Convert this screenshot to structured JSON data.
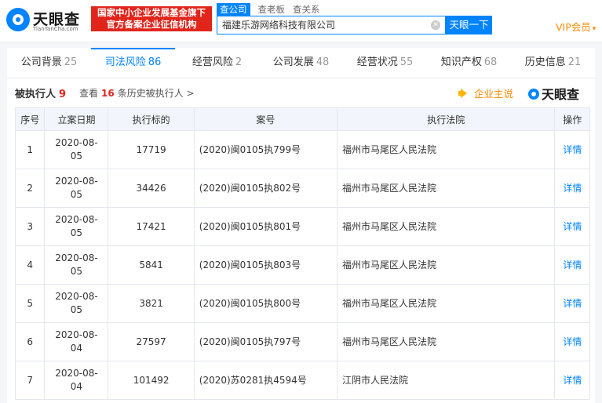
{
  "header": {
    "logo_text": "天眼查",
    "logo_sub": "TianYanCha.com",
    "banner_line1": "国家中小企业发展基金旗下",
    "banner_line2": "官方备案企业征信机构",
    "search_tabs": [
      "查公司",
      "查老板",
      "查关系"
    ],
    "search_value": "福建乐游网络科技有限公司",
    "search_button": "天眼一下",
    "vip_label": "VIP会员",
    "accent": "#0084ff"
  },
  "tabs": [
    {
      "label": "公司背景",
      "count": "25"
    },
    {
      "label": "司法风险",
      "count": "86"
    },
    {
      "label": "经营风险",
      "count": "2"
    },
    {
      "label": "公司发展",
      "count": "48"
    },
    {
      "label": "经营状况",
      "count": "55"
    },
    {
      "label": "知识产权",
      "count": "68"
    },
    {
      "label": "历史信息",
      "count": "21"
    }
  ],
  "section": {
    "title": "被执行人",
    "count": "9",
    "history_prefix": "查看",
    "history_count": "16",
    "history_suffix": "条历史被执行人 >",
    "speak_label": "企业主说",
    "brand": "天眼查"
  },
  "table": {
    "headers": [
      "序号",
      "立案日期",
      "执行标的",
      "案号",
      "执行法院",
      "操作"
    ],
    "rows": [
      {
        "no": "1",
        "date": "2020-08-05",
        "amount": "17719",
        "case": "(2020)闽0105执799号",
        "court": "福州市马尾区人民法院",
        "action": "详情"
      },
      {
        "no": "2",
        "date": "2020-08-05",
        "amount": "34426",
        "case": "(2020)闽0105执802号",
        "court": "福州市马尾区人民法院",
        "action": "详情"
      },
      {
        "no": "3",
        "date": "2020-08-05",
        "amount": "17421",
        "case": "(2020)闽0105执801号",
        "court": "福州市马尾区人民法院",
        "action": "详情"
      },
      {
        "no": "4",
        "date": "2020-08-05",
        "amount": "5841",
        "case": "(2020)闽0105执803号",
        "court": "福州市马尾区人民法院",
        "action": "详情"
      },
      {
        "no": "5",
        "date": "2020-08-05",
        "amount": "3821",
        "case": "(2020)闽0105执800号",
        "court": "福州市马尾区人民法院",
        "action": "详情"
      },
      {
        "no": "6",
        "date": "2020-08-04",
        "amount": "27597",
        "case": "(2020)闽0105执797号",
        "court": "福州市马尾区人民法院",
        "action": "详情"
      },
      {
        "no": "7",
        "date": "2020-08-04",
        "amount": "101492",
        "case": "(2020)苏0281执4594号",
        "court": "江阴市人民法院",
        "action": "详情"
      }
    ]
  }
}
